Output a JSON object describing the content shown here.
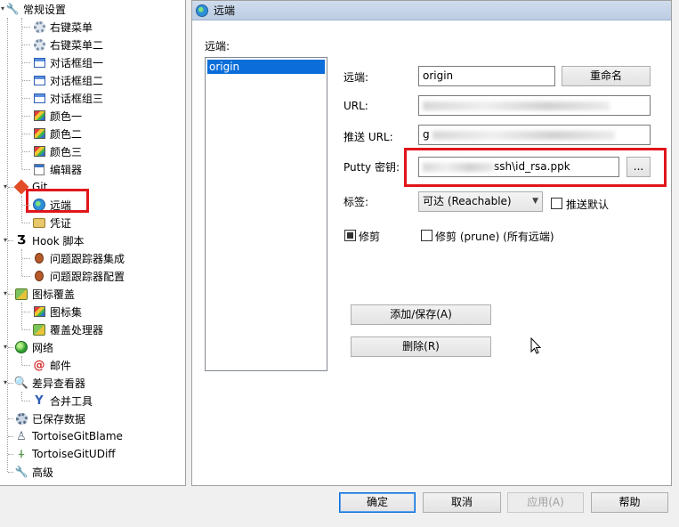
{
  "tree": {
    "items": [
      {
        "label": "常规设置",
        "icon": "wrench-icon"
      },
      {
        "label": "右键菜单",
        "icon": "gear-icon"
      },
      {
        "label": "右键菜单二",
        "icon": "gear-icon"
      },
      {
        "label": "对话框组一",
        "icon": "window-icon"
      },
      {
        "label": "对话框组二",
        "icon": "window-icon"
      },
      {
        "label": "对话框组三",
        "icon": "window-icon"
      },
      {
        "label": "颜色一",
        "icon": "color-icon"
      },
      {
        "label": "颜色二",
        "icon": "color-icon"
      },
      {
        "label": "颜色三",
        "icon": "color-icon"
      },
      {
        "label": "编辑器",
        "icon": "editor-icon"
      },
      {
        "label": "Git",
        "icon": "git-icon"
      },
      {
        "label": "远端",
        "icon": "globe-icon"
      },
      {
        "label": "凭证",
        "icon": "credential-icon"
      },
      {
        "label": "Hook 脚本",
        "icon": "hook-icon"
      },
      {
        "label": "问题跟踪器集成",
        "icon": "bug-icon"
      },
      {
        "label": "问题跟踪器配置",
        "icon": "bug-icon"
      },
      {
        "label": "图标覆盖",
        "icon": "overlay-icon"
      },
      {
        "label": "图标集",
        "icon": "color-icon"
      },
      {
        "label": "覆盖处理器",
        "icon": "overlay-icon"
      },
      {
        "label": "网络",
        "icon": "network-icon"
      },
      {
        "label": "邮件",
        "icon": "at-icon"
      },
      {
        "label": "差异查看器",
        "icon": "magnifier-icon"
      },
      {
        "label": "合并工具",
        "icon": "merge-icon"
      },
      {
        "label": "已保存数据",
        "icon": "saved-data-icon"
      },
      {
        "label": "TortoiseGitBlame",
        "icon": "blame-icon"
      },
      {
        "label": "TortoiseGitUDiff",
        "icon": "udiff-icon"
      },
      {
        "label": "高级",
        "icon": "wrench-icon"
      }
    ],
    "glyphs": {
      "wrench": "🔧",
      "hook": "Ʒ",
      "at": "@",
      "mag": "🔍",
      "merge": "Y",
      "blame": "♙",
      "udiff": "⍭"
    }
  },
  "panel": {
    "title": "远端",
    "remote_list_label": "远端:",
    "remotes": [
      "origin"
    ],
    "remote_label": "远端:",
    "remote_value": "origin",
    "rename_button": "重命名",
    "url_label": "URL:",
    "push_url_label": "推送 URL:",
    "push_url_visible_prefix": "g",
    "putty_label": "Putty 密钥:",
    "putty_value_visible": "ssh\\id_rsa.ppk",
    "browse_button": "...",
    "tag_label": "标签:",
    "tag_value": "可达 (Reachable)",
    "push_default_label": "推送默认",
    "prune_label": "修剪",
    "prune_all_label": "修剪 (prune) (所有远端)",
    "prune_checked": true,
    "prune_all_checked": false,
    "push_default_checked": false,
    "add_save_button": "添加/保存(A)",
    "delete_button": "删除(R)"
  },
  "footer": {
    "ok": "确定",
    "cancel": "取消",
    "apply": "应用(A)",
    "help": "帮助"
  },
  "colors": {
    "selection": "#0a6dd9",
    "highlight_red": "#e0161c"
  }
}
